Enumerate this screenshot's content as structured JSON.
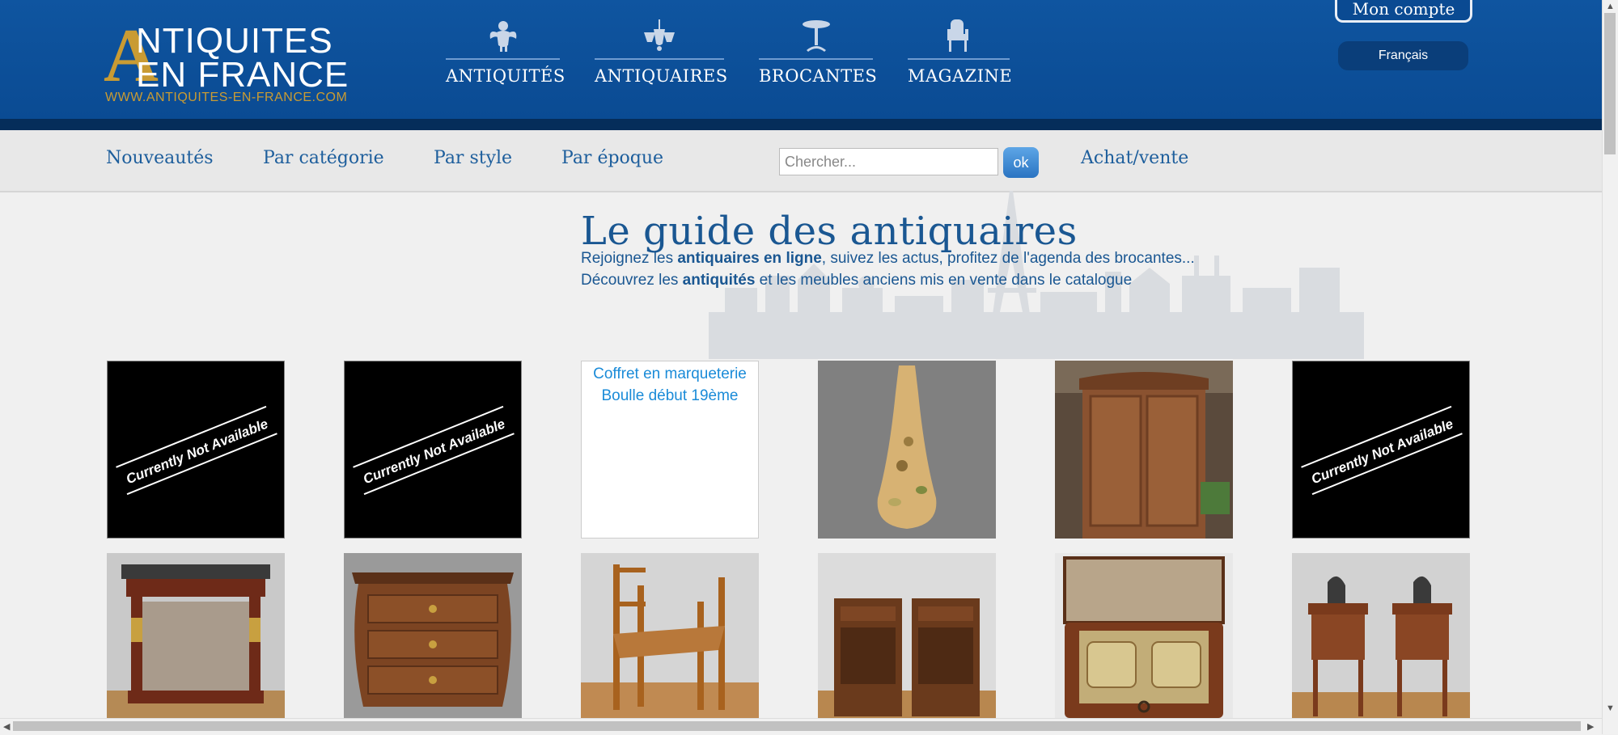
{
  "brand": {
    "logo_letter": "A",
    "logo_line1": "NTIQUITES",
    "logo_line2": "EN FRANCE",
    "logo_url": "WWW.ANTIQUITES-EN-FRANCE.COM"
  },
  "topnav": [
    {
      "label": "ANTIQUITÉS",
      "icon": "cherub-icon"
    },
    {
      "label": "ANTIQUAIRES",
      "icon": "chandelier-icon"
    },
    {
      "label": "BROCANTES",
      "icon": "pedestal-table-icon"
    },
    {
      "label": "MAGAZINE",
      "icon": "armchair-icon"
    }
  ],
  "account": {
    "label": "Mon compte",
    "language": "Français"
  },
  "subnav": {
    "items": [
      "Nouveautés",
      "Par catégorie",
      "Par style",
      "Par époque",
      "Achat/vente"
    ],
    "search_placeholder": "Chercher...",
    "search_button": "ok"
  },
  "hero": {
    "title": "Le guide des antiquaires",
    "line1_pre": "Rejoignez les ",
    "line1_bold": "antiquaires en ligne",
    "line1_post": ", suivez les actus, profitez de l'agenda des brocantes...",
    "line2_pre": "Découvrez les ",
    "line2_bold": "antiquités",
    "line2_post": " et les meubles anciens mis en vente dans le catalogue"
  },
  "products": [
    {
      "kind": "unavailable",
      "badge": "Currently Not Available"
    },
    {
      "kind": "unavailable",
      "badge": "Currently Not Available"
    },
    {
      "kind": "broken",
      "alt": "Coffret en marqueterie Boulle début 19ème"
    },
    {
      "kind": "photo",
      "subject": "vase"
    },
    {
      "kind": "photo",
      "subject": "armoire"
    },
    {
      "kind": "unavailable",
      "badge": "Currently Not Available"
    },
    {
      "kind": "photo",
      "subject": "console"
    },
    {
      "kind": "photo",
      "subject": "commode"
    },
    {
      "kind": "photo",
      "subject": "bamboo-chair"
    },
    {
      "kind": "photo",
      "subject": "nightstands"
    },
    {
      "kind": "photo",
      "subject": "inkwell-box"
    },
    {
      "kind": "photo",
      "subject": "side-tables"
    }
  ],
  "colors": {
    "header": "#0a4a92",
    "gold": "#c99b33",
    "link": "#1a5792"
  }
}
